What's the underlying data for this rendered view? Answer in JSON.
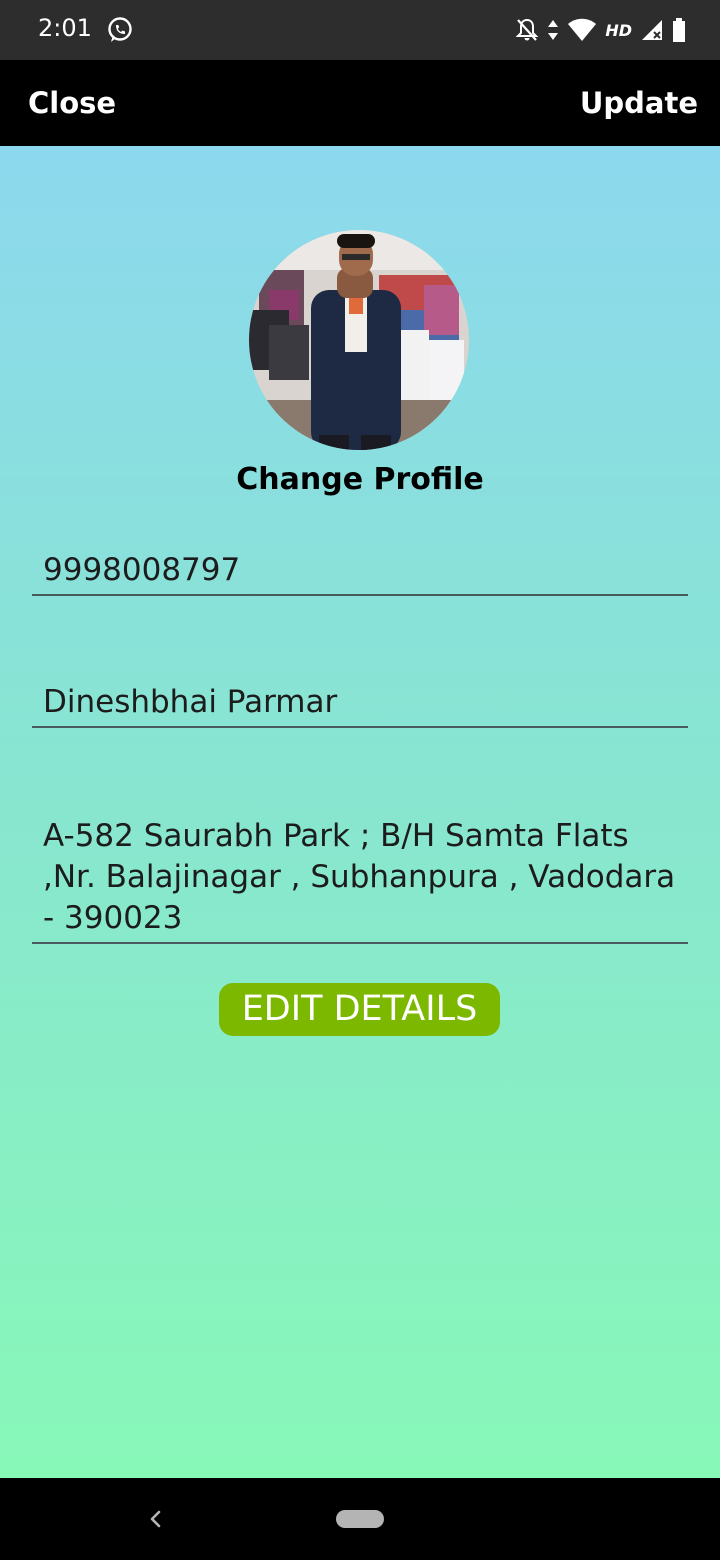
{
  "status_bar": {
    "time": "2:01",
    "network_label": "HD",
    "icons": [
      "whatsapp-icon",
      "notifications-off-icon",
      "data-arrows-icon",
      "wifi-icon",
      "cellular-signal-icon",
      "battery-icon"
    ]
  },
  "action_bar": {
    "close_label": "Close",
    "update_label": "Update"
  },
  "profile": {
    "change_profile_label": "Change Profile",
    "phone": "9998008797",
    "name": "Dineshbhai Parmar",
    "address": "A-582 Saurabh Park ; B/H Samta Flats ,Nr. Balajinagar , Subhanpura , Vadodara - 390023"
  },
  "buttons": {
    "edit_details_label": "EDIT DETAILS"
  },
  "colors": {
    "gradient_top": "#8cd8ee",
    "gradient_bottom": "#88f8b8",
    "edit_button": "#7cb800",
    "toolbar": "#000000",
    "status_bar": "#2d2d2d"
  }
}
